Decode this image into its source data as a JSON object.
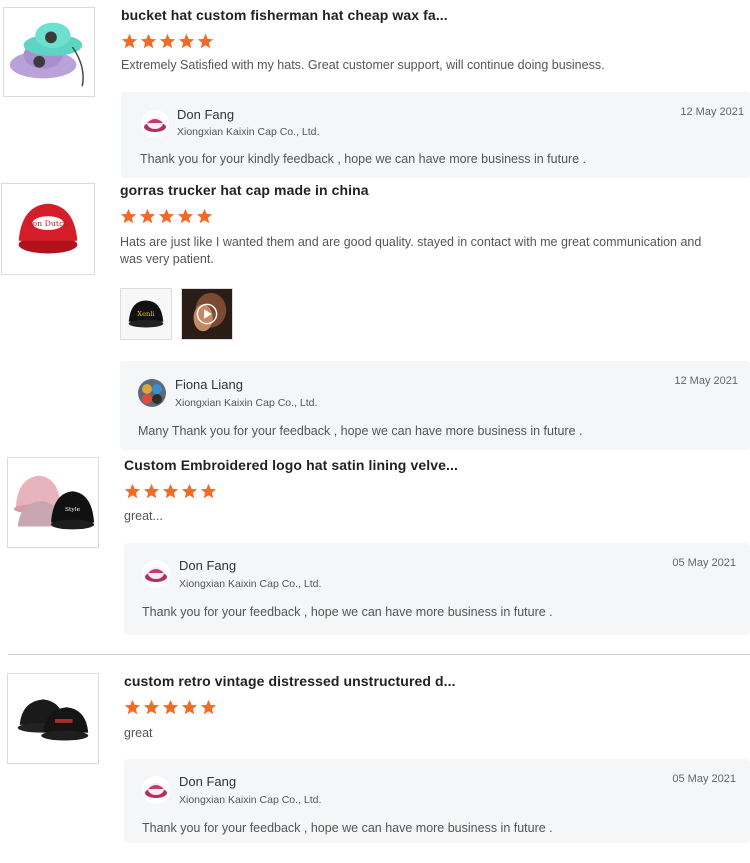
{
  "colors": {
    "star": "#f26a24",
    "reply_bg": "#f5f6f7",
    "divider": "#cfcfcf"
  },
  "reviews": [
    {
      "product_icon": "bucket-hat-photo",
      "title": "bucket hat custom fisherman hat cheap wax fa...",
      "rating": 5,
      "comment": "Extremely Satisfied with my hats. Great customer support, will continue doing business.",
      "reply": {
        "name": "Don Fang",
        "company": "Xiongxian Kaixin Cap Co., Ltd.",
        "date": "12 May 2021",
        "text": "Thank you for your kindly feedback , hope we can have more business in future ."
      }
    },
    {
      "product_icon": "trucker-cap-photo",
      "title": "gorras trucker hat cap made in china",
      "rating": 5,
      "comment": "Hats are just like I wanted them and are good quality. stayed in contact with me great communication and was very patient.",
      "media": [
        "cap-photo",
        "video-thumbnail"
      ],
      "reply": {
        "name": "Fiona Liang",
        "company": "Xiongxian Kaixin Cap Co., Ltd.",
        "date": "12 May 2021",
        "text": "Many Thank you for your feedback , hope we can have more business in future ."
      }
    },
    {
      "product_icon": "embroidered-caps-photo",
      "title": "Custom Embroidered logo hat satin lining velve...",
      "rating": 5,
      "comment": "great...",
      "reply": {
        "name": "Don Fang",
        "company": "Xiongxian Kaixin Cap Co., Ltd.",
        "date": "05 May 2021",
        "text": "Thank you for your feedback , hope we can have more business in future ."
      }
    },
    {
      "product_icon": "vintage-caps-photo",
      "title": "custom retro vintage distressed unstructured d...",
      "rating": 5,
      "comment": "great",
      "reply": {
        "name": "Don Fang",
        "company": "Xiongxian Kaixin Cap Co., Ltd.",
        "date": "05 May 2021",
        "text": "Thank you for your feedback , hope we can have more business in future ."
      }
    }
  ]
}
